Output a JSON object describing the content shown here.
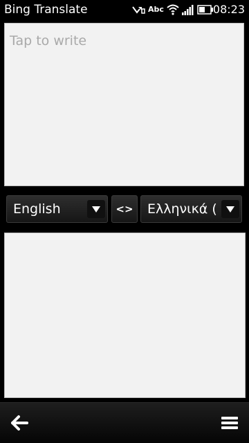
{
  "status_bar": {
    "app_title": "Bing Translate",
    "input_mode": "Abc",
    "clock": "08:23",
    "icons": [
      "missed-message-icon",
      "wifi-icon",
      "signal-icon",
      "battery-icon"
    ]
  },
  "input": {
    "placeholder": "Tap to write",
    "value": ""
  },
  "languages": {
    "source": "English",
    "swap_label": "<>",
    "target": "Ελληνικά ("
  },
  "output": {
    "value": ""
  },
  "toolbar": {
    "back_icon": "back-arrow-icon",
    "menu_icon": "menu-icon"
  },
  "colors": {
    "background": "#000000",
    "panel": "#f2f2f2",
    "placeholder": "#a9a9a9",
    "button_dark": "#1f1f1f",
    "text_light": "#ffffff"
  }
}
